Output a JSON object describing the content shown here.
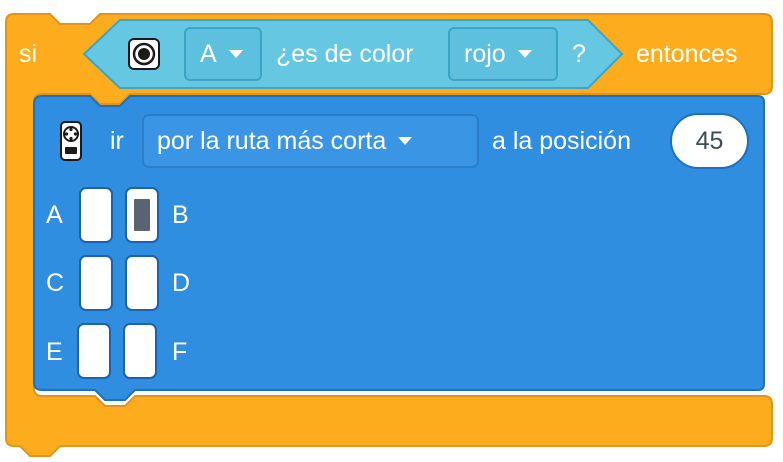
{
  "colors": {
    "outer_block": "#fcac1c",
    "outer_block_border": "#e0941a",
    "condition_block": "#66c7e3",
    "inner_block": "#2f8ee0",
    "inner_block_border": "#1f6fc0",
    "port_on": "#5a6470"
  },
  "if_block": {
    "si_label": "si",
    "then_label": "entonces"
  },
  "condition": {
    "sensor_icon": "color-sensor-icon",
    "port_value": "A",
    "question_label": "¿es de color",
    "color_value": "rojo",
    "question_mark": "?"
  },
  "motor_block": {
    "icon": "motor-icon",
    "go_label": "ir",
    "direction_value": "por la ruta más corta",
    "position_label": "a la posición",
    "position_value": "45"
  },
  "ports": {
    "selected": "B",
    "rows": [
      {
        "left": "A",
        "right": "B"
      },
      {
        "left": "C",
        "right": "D"
      },
      {
        "left": "E",
        "right": "F"
      }
    ]
  }
}
